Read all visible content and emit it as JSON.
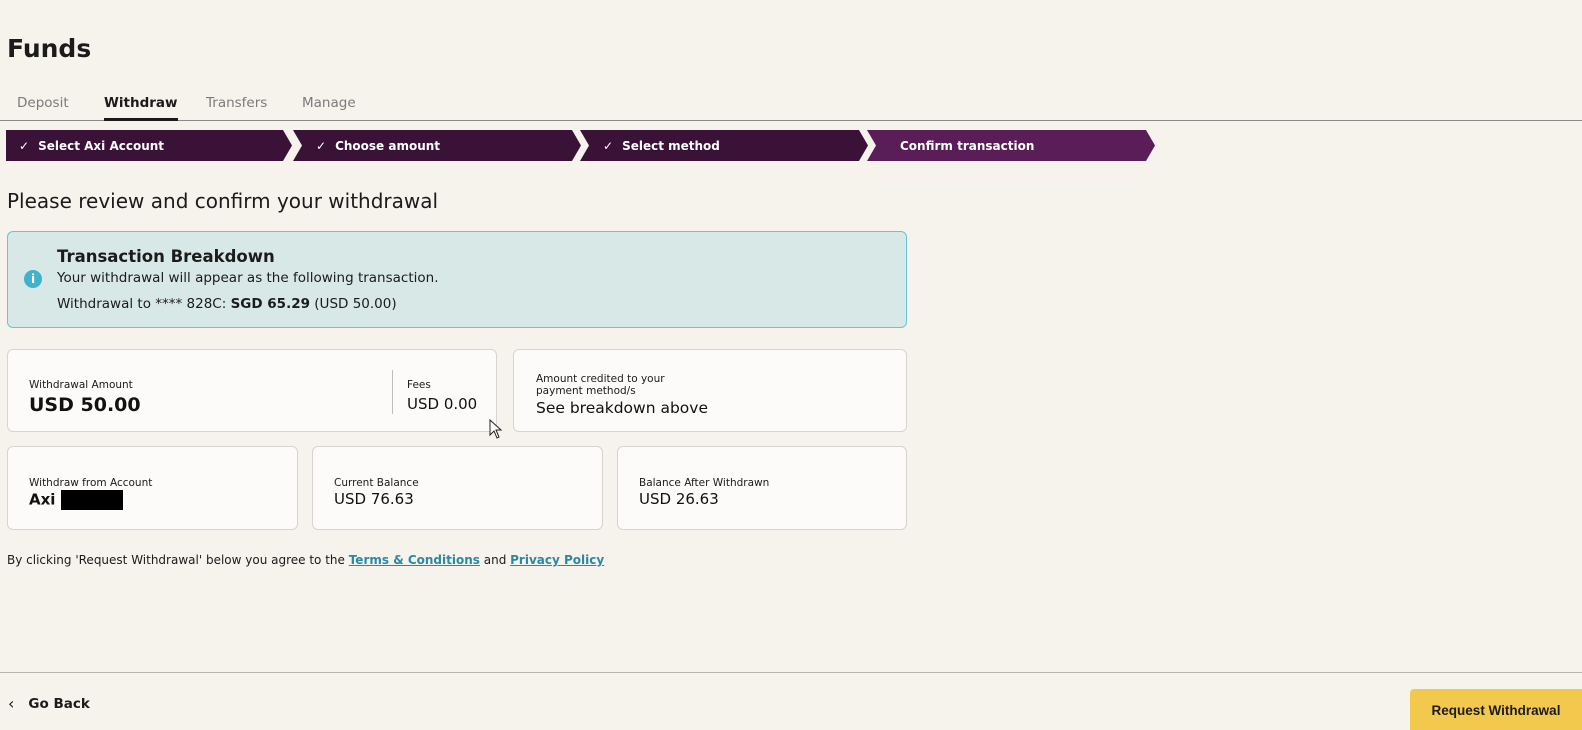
{
  "page": {
    "title": "Funds"
  },
  "tabs": [
    {
      "label": "Deposit",
      "active": false
    },
    {
      "label": "Withdraw",
      "active": true
    },
    {
      "label": "Transfers",
      "active": false
    },
    {
      "label": "Manage",
      "active": false
    }
  ],
  "stepper": {
    "steps": [
      {
        "label": "Select Axi Account",
        "done": true
      },
      {
        "label": "Choose amount",
        "done": true
      },
      {
        "label": "Select method",
        "done": true
      },
      {
        "label": "Confirm transaction",
        "done": false,
        "current": true
      }
    ],
    "check_icon": "check-icon"
  },
  "headline": "Please review and confirm your withdrawal",
  "info": {
    "icon": "info-icon",
    "title": "Transaction Breakdown",
    "subtitle": "Your withdrawal will appear as the following transaction.",
    "line_prefix": "Withdrawal to **** 828C: ",
    "line_amount": "SGD 65.29",
    "line_suffix": " (USD 50.00)"
  },
  "summary": {
    "withdrawal_amount_label": "Withdrawal Amount",
    "withdrawal_amount_value": "USD 50.00",
    "fees_label": "Fees",
    "fees_value": "USD 0.00",
    "credited_label_line1": "Amount credited to your",
    "credited_label_line2": "payment method/s",
    "credited_value": "See breakdown above",
    "from_account_label": "Withdraw from Account",
    "from_account_value": "Axi",
    "current_balance_label": "Current Balance",
    "current_balance_value": "USD 76.63",
    "balance_after_label": "Balance After Withdrawn",
    "balance_after_value": "USD 26.63"
  },
  "agreement": {
    "prefix": "By clicking 'Request Withdrawal' below you agree to the ",
    "terms_link": "Terms & Conditions",
    "middle": " and ",
    "privacy_link": "Privacy Policy"
  },
  "footer": {
    "go_back_label": "Go Back",
    "request_label": "Request Withdrawal",
    "request_color": "#f2c94c"
  },
  "colors": {
    "background": "#f6f2ec",
    "stepper_done": "#3a1238",
    "stepper_current": "#5b1d58",
    "info_bg": "#d8e8e6",
    "link": "#2a8aa4"
  }
}
